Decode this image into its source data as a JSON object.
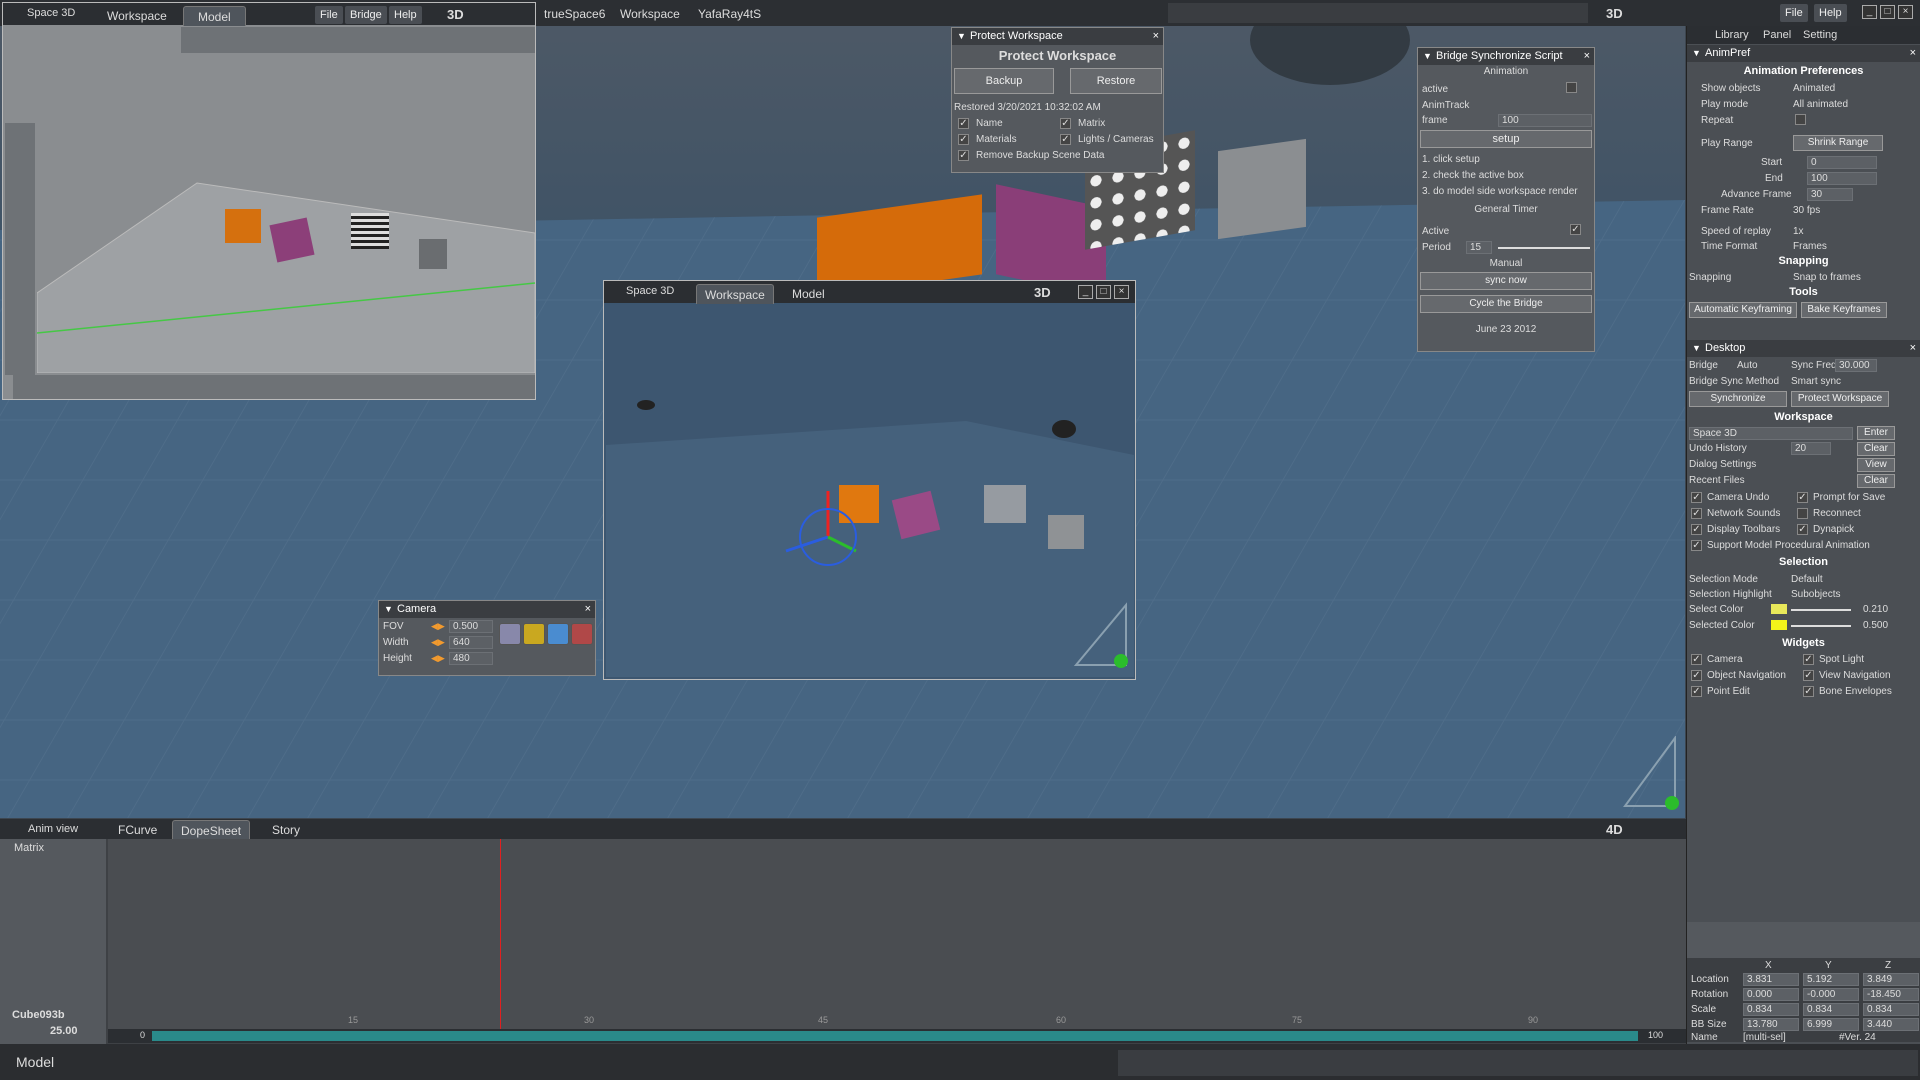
{
  "topbar": {
    "tabs": [
      "trueSpace6",
      "Workspace",
      "YafaRay4tS"
    ],
    "file_label": "File",
    "help_label": "Help",
    "mode_3d": "3D",
    "right_tabs": [
      "Library",
      "Panel",
      "Setting"
    ]
  },
  "mini_window": {
    "title": "Space 3D",
    "tabs": [
      "Workspace",
      "Model"
    ],
    "menu": [
      "File",
      "Bridge",
      "Help"
    ],
    "mode": "3D"
  },
  "protect_workspace": {
    "title": "Protect Workspace",
    "heading": "Protect Workspace",
    "backup_label": "Backup",
    "restore_label": "Restore",
    "restored_text": "Restored 3/20/2021  10:32:02 AM",
    "options": [
      "Name",
      "Matrix",
      "Materials",
      "Lights / Cameras",
      "Remove Backup Scene Data"
    ]
  },
  "bridge_script": {
    "title": "Bridge Synchronize Script",
    "animation_label": "Animation",
    "active_label": "active",
    "animtrack_label": "AnimTrack",
    "frame_label": "frame",
    "frame_value": "100",
    "setup_label": "setup",
    "steps": [
      "1. click setup",
      "2. check the active box",
      "3. do model side workspace render"
    ],
    "general_timer_label": "General Timer",
    "timer_active_label": "Active",
    "period_label": "Period",
    "period_value": "15",
    "manual_label": "Manual",
    "sync_now_label": "sync now",
    "cycle_label": "Cycle the Bridge",
    "date_text": "June 23 2012"
  },
  "render_window": {
    "title": "Space 3D",
    "tabs": [
      "Workspace",
      "Model"
    ],
    "mode": "3D"
  },
  "camera_panel": {
    "title": "Camera",
    "fov_label": "FOV",
    "fov_value": "0.500",
    "width_label": "Width",
    "width_value": "640",
    "height_label": "Height",
    "height_value": "480"
  },
  "anim_pref": {
    "title": "AnimPref",
    "heading": "Animation Preferences",
    "show_objects_label": "Show objects",
    "show_objects_value": "Animated",
    "play_mode_label": "Play mode",
    "play_mode_value": "All animated",
    "repeat_label": "Repeat",
    "play_range_label": "Play Range",
    "shrink_range_label": "Shrink Range",
    "start_label": "Start",
    "start_value": "0",
    "end_label": "End",
    "end_value": "100",
    "advance_label": "Advance Frame",
    "advance_value": "30",
    "frame_rate_label": "Frame Rate",
    "frame_rate_value": "30 fps",
    "speed_label": "Speed of replay",
    "speed_value": "1x",
    "time_format_label": "Time Format",
    "time_format_value": "Frames",
    "snapping_heading": "Snapping",
    "snapping_label": "Snapping",
    "snapping_value": "Snap to frames",
    "tools_heading": "Tools",
    "auto_key_label": "Automatic Keyframing",
    "bake_label": "Bake Keyframes"
  },
  "desktop": {
    "title": "Desktop",
    "bridge_label": "Bridge",
    "bridge_value": "Auto",
    "sync_freq_label": "Sync Freq",
    "sync_freq_value": "30.000",
    "bridge_sync_label": "Bridge Sync Method",
    "bridge_sync_value": "Smart sync",
    "synchronize_label": "Synchronize",
    "protect_label": "Protect Workspace",
    "workspace_heading": "Workspace",
    "space_value": "Space 3D",
    "enter_label": "Enter",
    "undo_label": "Undo History",
    "undo_value": "20",
    "clear_label": "Clear",
    "dialog_label": "Dialog Settings",
    "view_label": "View",
    "recent_label": "Recent Files",
    "clear2_label": "Clear",
    "checks_left": [
      "Camera Undo",
      "Network Sounds",
      "Display Toolbars"
    ],
    "checks_right": [
      "Prompt for Save",
      "Reconnect",
      "Dynapick"
    ],
    "support_label": "Support Model Procedural Animation",
    "selection_heading": "Selection",
    "sel_mode_label": "Selection Mode",
    "sel_mode_value": "Default",
    "sel_highlight_label": "Selection Highlight",
    "sel_highlight_value": "Subobjects",
    "select_color_label": "Select Color",
    "select_color_value": "0.210",
    "selected_color_label": "Selected Color",
    "selected_color_value": "0.500",
    "widgets_heading": "Widgets",
    "widgets_left": [
      "Camera",
      "Object Navigation",
      "Point Edit"
    ],
    "widgets_right": [
      "Spot Light",
      "View Navigation",
      "Bone Envelopes"
    ]
  },
  "transform": {
    "headers": [
      "X",
      "Y",
      "Z"
    ],
    "rows": [
      {
        "label": "Location",
        "x": "3.831",
        "y": "5.192",
        "z": "3.849"
      },
      {
        "label": "Rotation",
        "x": "0.000",
        "y": "-0.000",
        "z": "-18.450"
      },
      {
        "label": "Scale",
        "x": "0.834",
        "y": "0.834",
        "z": "0.834"
      },
      {
        "label": "BB Size",
        "x": "13.780",
        "y": "6.999",
        "z": "3.440"
      }
    ],
    "name_label": "Name",
    "name_value": "[multi-sel]",
    "version": "#Ver. 24"
  },
  "timeline": {
    "anim_view_label": "Anim view",
    "tabs": [
      "FCurve",
      "DopeSheet",
      "Story"
    ],
    "mode": "4D",
    "matrix_label": "Matrix",
    "object_name": "Cube093b",
    "current_frame": "25.00",
    "ticks": [
      "15",
      "30",
      "45",
      "60",
      "75",
      "90"
    ],
    "range_start": "0",
    "range_end": "100"
  },
  "status": {
    "mode": "Model"
  },
  "colors": {
    "accent": "#f29a2e",
    "select_color": "#e8e85a",
    "selected_color": "#f3f31a"
  }
}
